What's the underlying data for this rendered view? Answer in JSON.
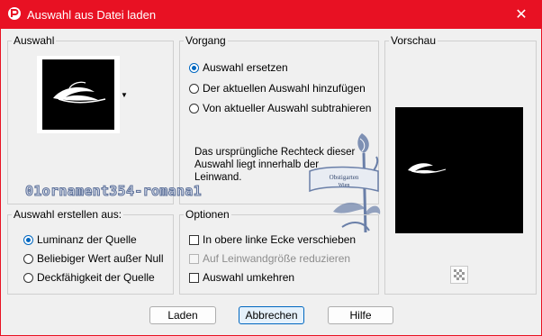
{
  "window": {
    "title": "Auswahl aus Datei laden"
  },
  "auswahl": {
    "label": "Auswahl"
  },
  "vorgang": {
    "label": "Vorgang",
    "options": [
      "Auswahl ersetzen",
      "Der aktuellen Auswahl hinzufügen",
      "Von aktueller Auswahl subtrahieren"
    ],
    "selected": 0,
    "info_lines": [
      "Das ursprüngliche Rechteck dieser",
      "Auswahl liegt innerhalb der",
      "Leinwand."
    ]
  },
  "vorschau": {
    "label": "Vorschau"
  },
  "watermark": {
    "text": "01ornament354-romana1",
    "stamp_line1": "Obstigarten",
    "stamp_line2": "Wien"
  },
  "erstellen": {
    "label": "Auswahl erstellen aus:",
    "options": [
      "Luminanz der Quelle",
      "Beliebiger Wert außer Null",
      "Deckfähigkeit der Quelle"
    ],
    "selected": 0
  },
  "optionen": {
    "label": "Optionen",
    "items": [
      {
        "label": "In obere linke Ecke verschieben",
        "checked": false,
        "enabled": true
      },
      {
        "label": "Auf Leinwandgröße reduzieren",
        "checked": false,
        "enabled": false
      },
      {
        "label": "Auswahl umkehren",
        "checked": false,
        "enabled": true
      }
    ]
  },
  "buttons": {
    "load": "Laden",
    "cancel": "Abbrechen",
    "help": "Hilfe"
  },
  "colors": {
    "titlebar": "#e81123",
    "accent": "#0067c0",
    "watermark": "#6a7fa8"
  }
}
